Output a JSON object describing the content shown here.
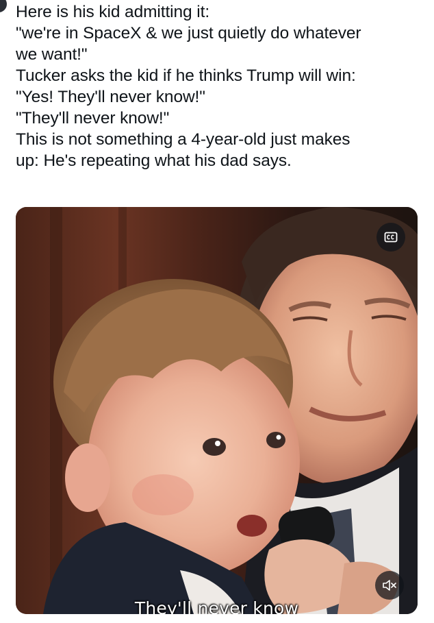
{
  "tweet": {
    "lines": [
      "Here is his kid admitting it:",
      "\"we're in SpaceX & we just quietly do whatever",
      "we want!\"",
      "Tucker asks the kid if he thinks Trump will win:",
      "\"Yes! They'll never know!\"",
      "\"They'll never know!\"",
      "This is not something a 4-year-old just makes",
      "up: He's repeating what his dad says."
    ]
  },
  "video": {
    "caption": "They'll never know",
    "cc_icon": "closed-captions-icon",
    "mute_icon": "speaker-muted-icon"
  },
  "colors": {
    "text": "#0f1419",
    "overlay_button": "#0f1419"
  }
}
